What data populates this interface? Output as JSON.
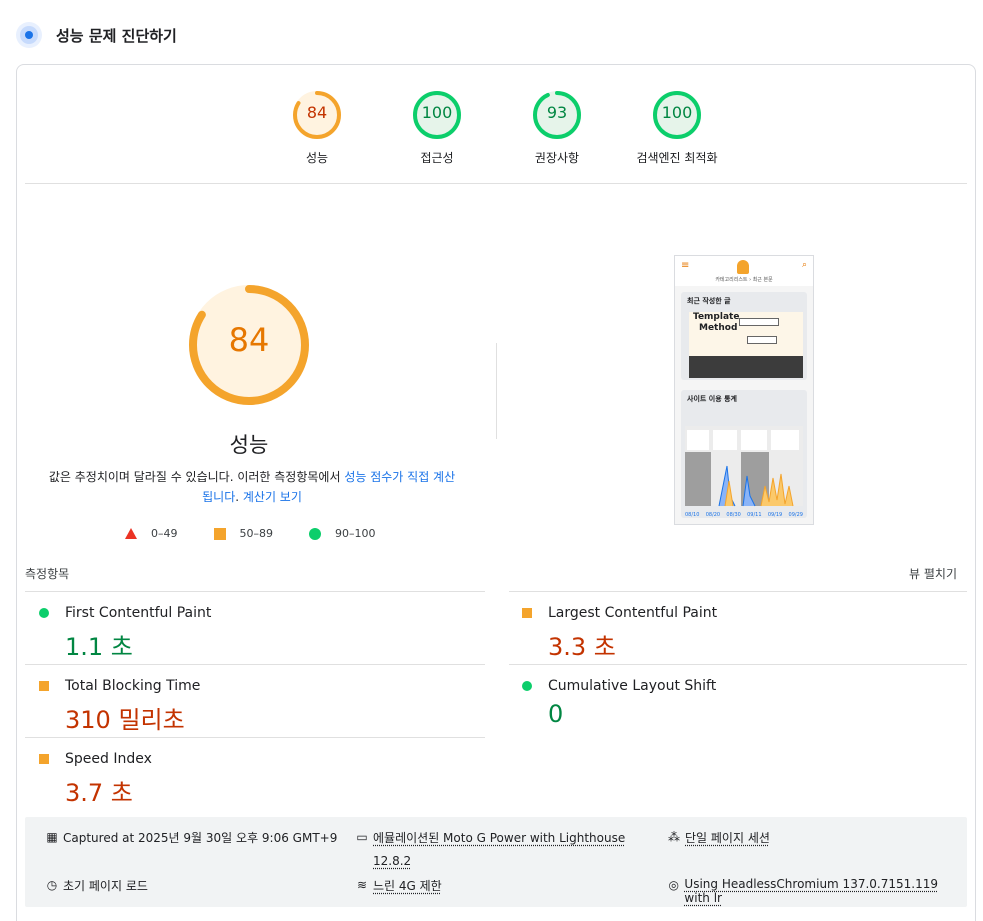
{
  "header": {
    "title": "성능 문제 진단하기"
  },
  "gauges": [
    {
      "label": "성능",
      "score": "84",
      "value": 84,
      "color": "#f4a42c",
      "text_color": "#c33300",
      "fill": "#fff3e0"
    },
    {
      "label": "접근성",
      "score": "100",
      "value": 100,
      "color": "#0cce6b",
      "text_color": "#018642",
      "fill": "#e6f4ea"
    },
    {
      "label": "권장사항",
      "score": "93",
      "value": 93,
      "color": "#0cce6b",
      "text_color": "#018642",
      "fill": "#e6f4ea"
    },
    {
      "label": "검색엔진 최적화",
      "score": "100",
      "value": 100,
      "color": "#0cce6b",
      "text_color": "#018642",
      "fill": "#e6f4ea"
    }
  ],
  "main": {
    "score": "84",
    "score_value": 84,
    "title": "성능",
    "desc_part1": "값은 추정치이며 달라질 수 있습니다. 이러한 측정항목에서 ",
    "desc_link1": "성능 점수가 직접 계산됩니다",
    "desc_part2": ". ",
    "desc_link2": "계산기 보기"
  },
  "legend": [
    {
      "shape": "triangle",
      "label": "0–49"
    },
    {
      "shape": "square",
      "label": "50–89"
    },
    {
      "shape": "circle",
      "label": "90–100"
    }
  ],
  "thumbnail": {
    "crumb": "카테고리리스트 › 최근 본문",
    "panel1_title": "최근 작성한 글",
    "template_text1": "Template",
    "template_text2": "Method",
    "panel2_title": "사이트 이용 통계",
    "axis_labels": [
      "08/10",
      "08/20",
      "08/30",
      "09/11",
      "09/19",
      "09/29"
    ]
  },
  "metrics": {
    "title": "측정항목",
    "toggle": "뷰 펼치기",
    "items": [
      {
        "name": "First Contentful Paint",
        "value": "1.1 초",
        "status": "green"
      },
      {
        "name": "Largest Contentful Paint",
        "value": "3.3 초",
        "status": "orange"
      },
      {
        "name": "Total Blocking Time",
        "value": "310 밀리초",
        "status": "orange"
      },
      {
        "name": "Cumulative Layout Shift",
        "value": "0",
        "status": "green"
      },
      {
        "name": "Speed Index",
        "value": "3.7 초",
        "status": "orange"
      }
    ]
  },
  "info": {
    "captured": "Captured at 2025년 9월 30일 오후 9:06 GMT+9",
    "device_line1": "에뮬레이션된 Moto G Power with Lighthouse",
    "device_line2": "12.8.2",
    "session": "단일 페이지 세션",
    "load": "초기 페이지 로드",
    "network": "느린 4G 제한",
    "browser": "Using HeadlessChromium 137.0.7151.119 with lr"
  }
}
